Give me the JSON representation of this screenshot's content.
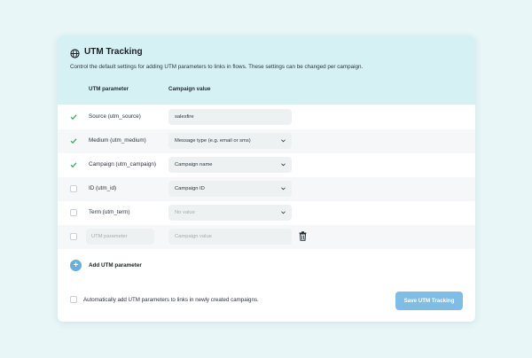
{
  "header": {
    "title": "UTM Tracking",
    "description": "Control the default settings for adding UTM parameters to links in flows. These settings can be changed per campaign."
  },
  "columns": {
    "parameter": "UTM parameter",
    "value": "Campaign value"
  },
  "rows": [
    {
      "checked": true,
      "label": "Source (utm_source)",
      "value": "salesfire",
      "type": "text"
    },
    {
      "checked": true,
      "label": "Medium (utm_medium)",
      "value": "Message type (e.g. email or sms)",
      "type": "select"
    },
    {
      "checked": true,
      "label": "Campaign (utm_campaign)",
      "value": "Campaign name",
      "type": "select"
    },
    {
      "checked": false,
      "label": "ID (utm_id)",
      "value": "Campaign ID",
      "type": "select"
    },
    {
      "checked": false,
      "label": "Term (utm_term)",
      "value": "No value",
      "type": "select"
    }
  ],
  "custom_row": {
    "param_placeholder": "UTM parameter",
    "value_placeholder": "Campaign value"
  },
  "add_label": "Add UTM parameter",
  "auto_label": "Automatically add UTM parameters to links in newly created campaigns.",
  "save_label": "Save UTM Tracking",
  "colors": {
    "accent": "#7fbde4",
    "header_bg": "#d6f1f3",
    "check": "#3fa96a"
  }
}
